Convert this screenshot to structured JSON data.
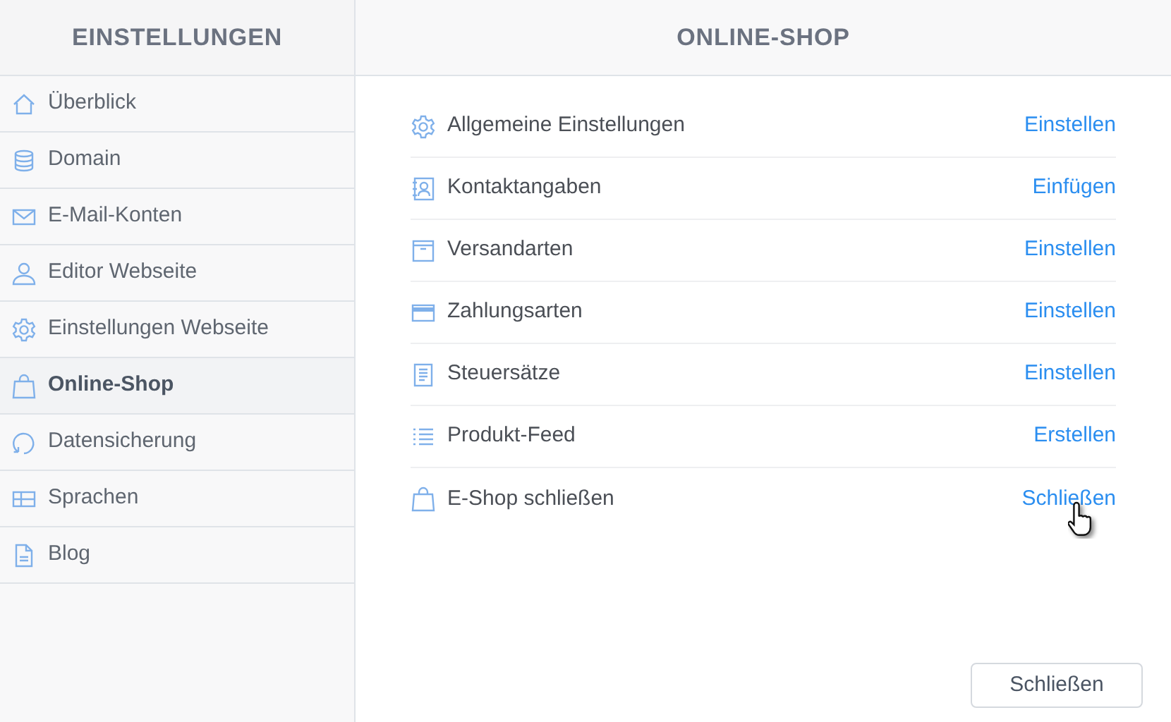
{
  "sidebar": {
    "title": "EINSTELLUNGEN",
    "items": [
      {
        "label": "Überblick",
        "selected": false
      },
      {
        "label": "Domain",
        "selected": false
      },
      {
        "label": "E-Mail-Konten",
        "selected": false
      },
      {
        "label": "Editor Webseite",
        "selected": false
      },
      {
        "label": "Einstellungen Webseite",
        "selected": false
      },
      {
        "label": "Online-Shop",
        "selected": true
      },
      {
        "label": "Datensicherung",
        "selected": false
      },
      {
        "label": "Sprachen",
        "selected": false
      },
      {
        "label": "Blog",
        "selected": false
      }
    ]
  },
  "main": {
    "title": "ONLINE-SHOP",
    "rows": [
      {
        "label": "Allgemeine Einstellungen",
        "action": "Einstellen"
      },
      {
        "label": "Kontaktangaben",
        "action": "Einfügen"
      },
      {
        "label": "Versandarten",
        "action": "Einstellen"
      },
      {
        "label": "Zahlungsarten",
        "action": "Einstellen"
      },
      {
        "label": "Steuersätze",
        "action": "Einstellen"
      },
      {
        "label": "Produkt-Feed",
        "action": "Erstellen"
      },
      {
        "label": "E-Shop schließen",
        "action": "Schließen"
      }
    ],
    "close_button": "Schließen"
  }
}
